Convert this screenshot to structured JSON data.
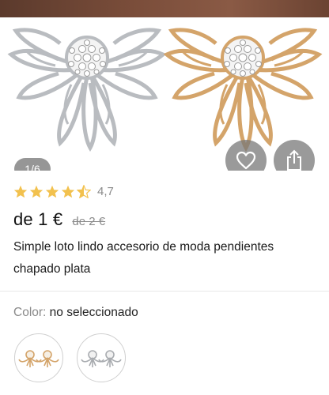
{
  "gallery": {
    "counter": "1/6",
    "wish_icon": "heart-outline-icon",
    "share_icon": "share-icon"
  },
  "product": {
    "rating_value": "4,7",
    "stars": 4.5,
    "price": "de 1 €",
    "old_price": "de 2 €",
    "title": "Simple loto lindo accesorio de moda pendientes chapado plata"
  },
  "options": {
    "color_label": "Color:",
    "color_value": "no seleccionado"
  },
  "colors": {
    "star": "#f2c14e",
    "silver": "#b9bcc0",
    "gold": "#d4a46a"
  }
}
